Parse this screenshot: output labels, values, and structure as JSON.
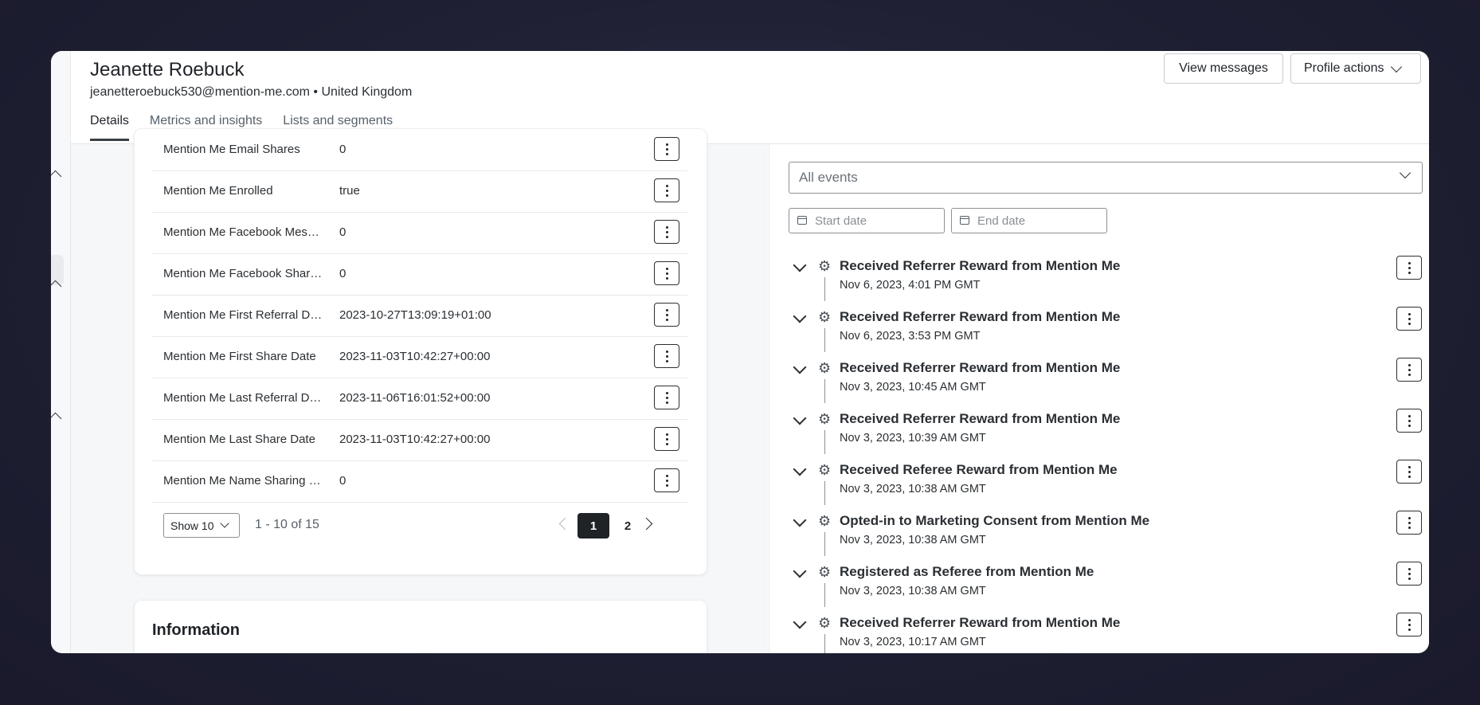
{
  "profile": {
    "name": "Jeanette Roebuck",
    "subline": "jeanetteroebuck530@mention-me.com • United Kingdom"
  },
  "header": {
    "view_messages": "View messages",
    "profile_actions": "Profile actions"
  },
  "tabs": [
    "Details",
    "Metrics and insights",
    "Lists and segments"
  ],
  "attributes": [
    {
      "key": "Mention Me Email Shares",
      "value": "0"
    },
    {
      "key": "Mention Me Enrolled",
      "value": "true"
    },
    {
      "key": "Mention Me Facebook Mess...",
      "value": "0"
    },
    {
      "key": "Mention Me Facebook Shares",
      "value": "0"
    },
    {
      "key": "Mention Me First Referral Date",
      "value": "2023-10-27T13:09:19+01:00"
    },
    {
      "key": "Mention Me First Share Date",
      "value": "2023-11-03T10:42:27+00:00"
    },
    {
      "key": "Mention Me Last Referral Date",
      "value": "2023-11-06T16:01:52+00:00"
    },
    {
      "key": "Mention Me Last Share Date",
      "value": "2023-11-03T10:42:27+00:00"
    },
    {
      "key": "Mention Me Name Sharing S...",
      "value": "0"
    }
  ],
  "pager": {
    "show": "Show 10",
    "range": "1 - 10 of 15",
    "page1": "1",
    "page2": "2"
  },
  "info_card": {
    "title": "Information"
  },
  "events_filter": {
    "selected": "All events",
    "start_placeholder": "Start date",
    "end_placeholder": "End date"
  },
  "events": [
    {
      "title": "Received Referrer Reward from Mention Me",
      "time": "Nov 6, 2023, 4:01 PM GMT"
    },
    {
      "title": "Received Referrer Reward from Mention Me",
      "time": "Nov 6, 2023, 3:53 PM GMT"
    },
    {
      "title": "Received Referrer Reward from Mention Me",
      "time": "Nov 3, 2023, 10:45 AM GMT"
    },
    {
      "title": "Received Referrer Reward from Mention Me",
      "time": "Nov 3, 2023, 10:39 AM GMT"
    },
    {
      "title": "Received Referee Reward from Mention Me",
      "time": "Nov 3, 2023, 10:38 AM GMT"
    },
    {
      "title": "Opted-in to Marketing Consent from Mention Me",
      "time": "Nov 3, 2023, 10:38 AM GMT"
    },
    {
      "title": "Registered as Referee from Mention Me",
      "time": "Nov 3, 2023, 10:38 AM GMT"
    },
    {
      "title": "Received Referrer Reward from Mention Me",
      "time": "Nov 3, 2023, 10:17 AM GMT"
    }
  ],
  "icons": {
    "event_type": "gear-icon",
    "calendar": "calendar-icon",
    "more": "more-vertical-icon"
  }
}
